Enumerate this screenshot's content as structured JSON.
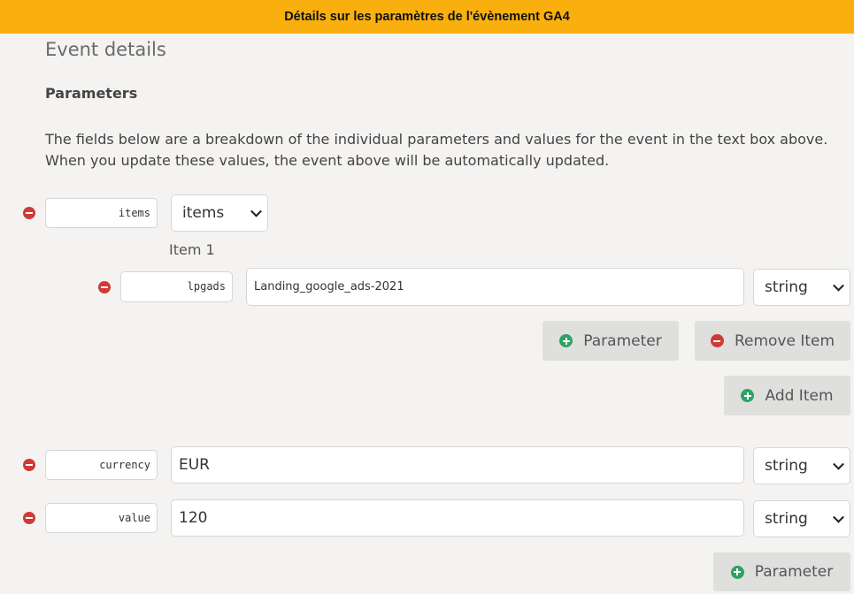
{
  "banner": {
    "title": "Détails sur les paramètres de l'évènement GA4"
  },
  "header": {
    "title": "Event details",
    "subtitle": "Parameters"
  },
  "description": {
    "line1": "The fields below are a breakdown of the individual parameters and values for the event in the text box above.",
    "line2": "When you update these values, the event above will be automatically updated."
  },
  "params": {
    "items": {
      "key": "items",
      "type": "items"
    },
    "item1": {
      "label": "Item 1",
      "key": "lpgads",
      "value": "Landing_google_ads-2021",
      "type": "string",
      "add_param_label": "Parameter",
      "remove_item_label": "Remove Item"
    },
    "add_item_label": "Add Item",
    "currency": {
      "key": "currency",
      "value": "EUR",
      "type": "string"
    },
    "value": {
      "key": "value",
      "value": "120",
      "type": "string"
    },
    "add_param_label": "Parameter"
  },
  "colors": {
    "banner": "#f9b00e",
    "remove": "#d03a35",
    "add": "#2fa263",
    "background": "#f4f3f1"
  },
  "icons": {
    "remove": "minus-circle-icon",
    "add": "plus-circle-icon",
    "dropdown": "chevron-down-icon"
  }
}
